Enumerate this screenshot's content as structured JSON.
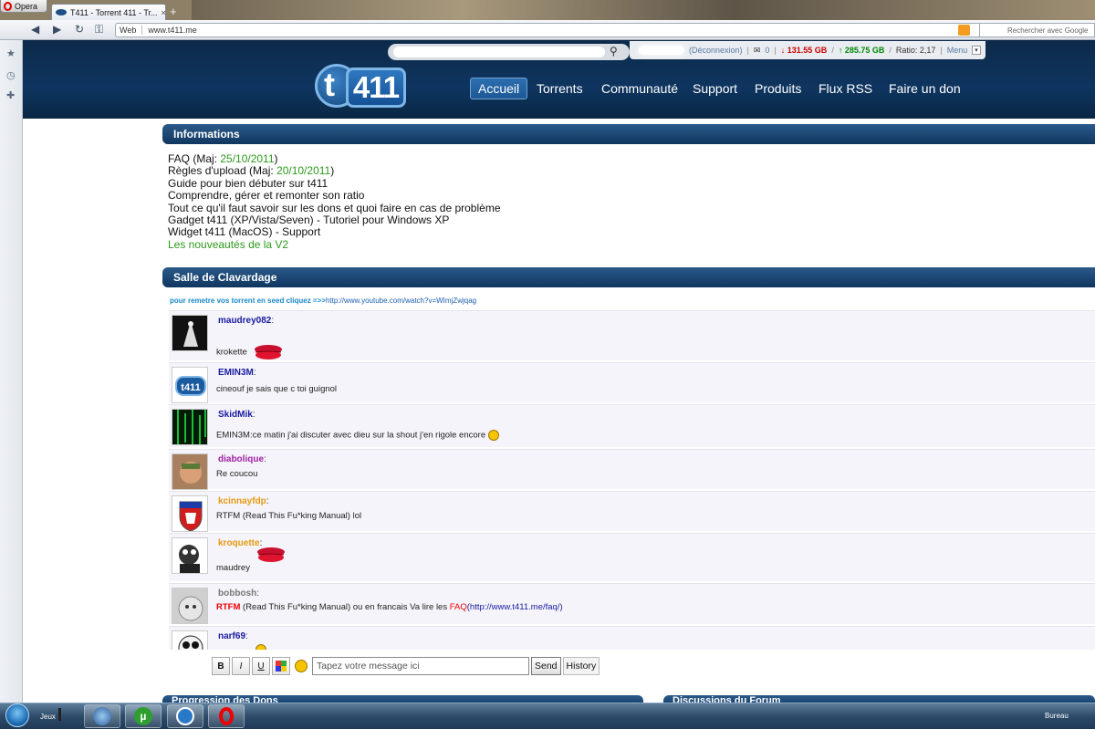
{
  "browser": {
    "opera_label": "Opera",
    "tab_title": "T411 - Torrent 411 - Tr...",
    "tab_close": "×",
    "new_tab": "+",
    "address_web": "Web",
    "address_url": "www.t411.me",
    "search_placeholder": "Rechercher avec Google"
  },
  "site": {
    "userbar": {
      "logout": "(Déconnexion)",
      "messages": "0",
      "download": "↓ 131.55 GB",
      "upload": "↑ 285.75 GB",
      "ratio": "Ratio: 2,17",
      "menu": "Menu"
    },
    "logo_t": "t",
    "logo_num": "411",
    "nav": [
      "Accueil",
      "Torrents",
      "Communauté",
      "Support",
      "Produits",
      "Flux RSS",
      "Faire un don"
    ]
  },
  "informations": {
    "title": "Informations",
    "lines": [
      {
        "text": "FAQ (Maj: ",
        "date": "25/10/2011",
        "tail": ")"
      },
      {
        "text": "Règles d'upload (Maj: ",
        "date": "20/10/2011",
        "tail": ")"
      },
      {
        "text": "Guide pour bien débuter sur t411"
      },
      {
        "text": "Comprendre, gérer et remonter son ratio"
      },
      {
        "text": "Tout ce qu'il faut savoir sur les dons et quoi faire en cas de problème"
      },
      {
        "text": "Gadget t411 (XP/Vista/Seven) - Tutoriel pour Windows XP"
      },
      {
        "text": "Widget t411 (MacOS) - Support"
      },
      {
        "green": "Les nouveautés de la V2"
      }
    ]
  },
  "chat": {
    "title": "Salle de Clavardage",
    "seed_prefix": "pour remetre vos torrent en seed cliquez =>>",
    "seed_url": "http://www.youtube.com/watch?v=WImjZwjqag",
    "messages": [
      {
        "user": "maudrey082",
        "color": "#1a1aa0",
        "text": "krokette"
      },
      {
        "user": "EMIN3M",
        "color": "#1a1aa0",
        "text": "cineouf je sais que c toi guignol"
      },
      {
        "user": "SkidMik",
        "color": "#1a1aa0",
        "text": "EMIN3M:ce matin j'ai discuter avec dieu sur la shout j'en rigole encore"
      },
      {
        "user": "diabolique",
        "color": "#a020a0",
        "text": "Re coucou"
      },
      {
        "user": "kcinnayfdp",
        "color": "#e89a10",
        "text": "RTFM (Read This Fu*king Manual) lol"
      },
      {
        "user": "kroquette",
        "color": "#e89a10",
        "text": "maudrey"
      },
      {
        "user": "bobbosh",
        "color": "#777777",
        "text_red": "RTFM",
        "text": " (Read This Fu*king Manual) ou en francais Va lire les ",
        "text_faq": "FAQ",
        "text_link": "(http://www.t411.me/faq/)"
      },
      {
        "user": "narf69",
        "color": "#1a1aa0",
        "text": ""
      }
    ],
    "tools": {
      "bold": "B",
      "italic": "I",
      "underline": "U"
    },
    "input_placeholder": "Tapez votre message ici",
    "send": "Send",
    "history": "History"
  },
  "bottom": {
    "left_title": "Progression des Dons",
    "right_title": "Discussions du Forum"
  },
  "taskbar": {
    "jeux": "Jeux",
    "bureau": "Bureau"
  }
}
